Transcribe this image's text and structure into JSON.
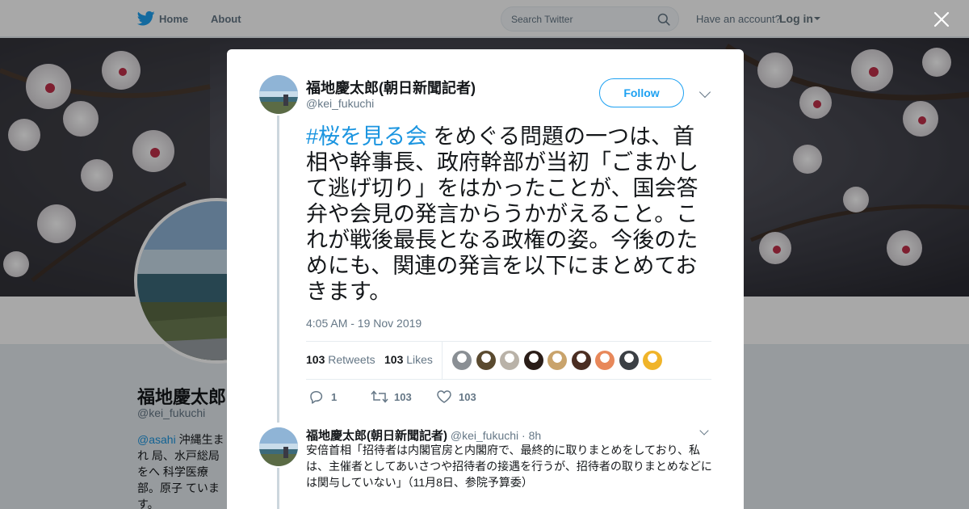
{
  "nav": {
    "home_label": "Home",
    "about_label": "About",
    "search_placeholder": "Search Twitter",
    "have_account": "Have an account?",
    "login_label": "Log in"
  },
  "background_profile": {
    "name": "福地慶太郎(",
    "handle": "@kei_fukuchi",
    "bio_link": "@asahi",
    "bio_text": " 沖縄生まれ 局、水戸総局をへ 科学医療部。原子 ています。"
  },
  "tweet": {
    "author_name": "福地慶太郎(朝日新聞記者)",
    "author_handle": "@kei_fukuchi",
    "follow_label": "Follow",
    "hashtag": "#桜を見る会",
    "text": " をめぐる問題の一つは、首相や幹事長、政府幹部が当初「ごまかして逃げ切り」をはかったことが、国会答弁や会見の発言からうかがえること。これが戦後最長となる政権の姿。今後のためにも、関連の発言を以下にまとめておきます。",
    "timestamp": "4:05 AM - 19 Nov 2019",
    "retweets_count": "103",
    "retweets_label": "Retweets",
    "likes_count": "103",
    "likes_label": "Likes",
    "reply_count": "1",
    "retweet_action_count": "103",
    "like_action_count": "103",
    "likers": [
      {
        "icon": "liker-avatar-1",
        "color": "#8a8f94"
      },
      {
        "icon": "liker-avatar-2",
        "color": "#5a4a2f"
      },
      {
        "icon": "liker-avatar-3",
        "color": "#b9b2a8"
      },
      {
        "icon": "liker-avatar-4",
        "color": "#2a1d18"
      },
      {
        "icon": "liker-avatar-5",
        "color": "#c9a36b"
      },
      {
        "icon": "liker-avatar-6",
        "color": "#4b2e22"
      },
      {
        "icon": "liker-avatar-7",
        "color": "#e8885a"
      },
      {
        "icon": "liker-avatar-8",
        "color": "#3b3f44"
      },
      {
        "icon": "liker-avatar-9",
        "color": "#f0b429"
      }
    ]
  },
  "reply_tweet": {
    "author_name": "福地慶太郎(朝日新聞記者)",
    "author_handle": "@kei_fukuchi",
    "age": "· 8h",
    "text": "安倍首相「招待者は内閣官房と内閣府で、最終的に取りまとめをしており、私は、主催者としてあいさつや招待者の接遇を行うが、招待者の取りまとめなどには関与していない」（11月8日、参院予算委）"
  },
  "colors": {
    "accent": "#1da1f2",
    "link": "#1b95e0",
    "muted": "#657786",
    "thread_line": "#ccd6dd"
  }
}
